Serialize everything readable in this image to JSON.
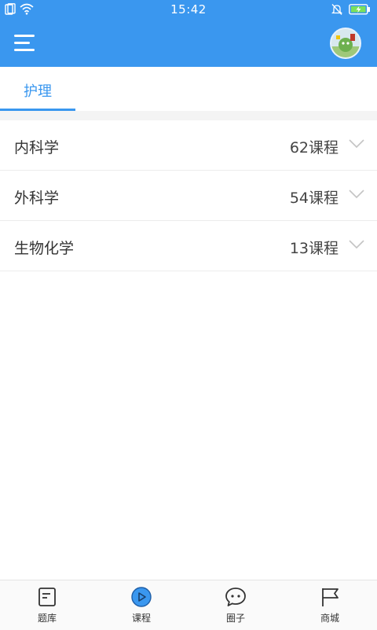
{
  "status_bar": {
    "time": "15:42"
  },
  "app_bar": {
    "accent_color": "#3a97ef",
    "menu_icon": "hamburger-menu-icon",
    "avatar_icon": "user-avatar"
  },
  "tabs": [
    {
      "label": "护理",
      "active": true
    }
  ],
  "list": [
    {
      "title": "内科学",
      "count": "62课程"
    },
    {
      "title": "外科学",
      "count": "54课程"
    },
    {
      "title": "生物化学",
      "count": "13课程"
    }
  ],
  "bottom_nav": [
    {
      "label": "题库",
      "icon": "question-bank-icon",
      "active": false
    },
    {
      "label": "课程",
      "icon": "play-circle-icon",
      "active": true
    },
    {
      "label": "圈子",
      "icon": "chat-bubble-icon",
      "active": false
    },
    {
      "label": "商城",
      "icon": "flag-icon",
      "active": false
    }
  ]
}
